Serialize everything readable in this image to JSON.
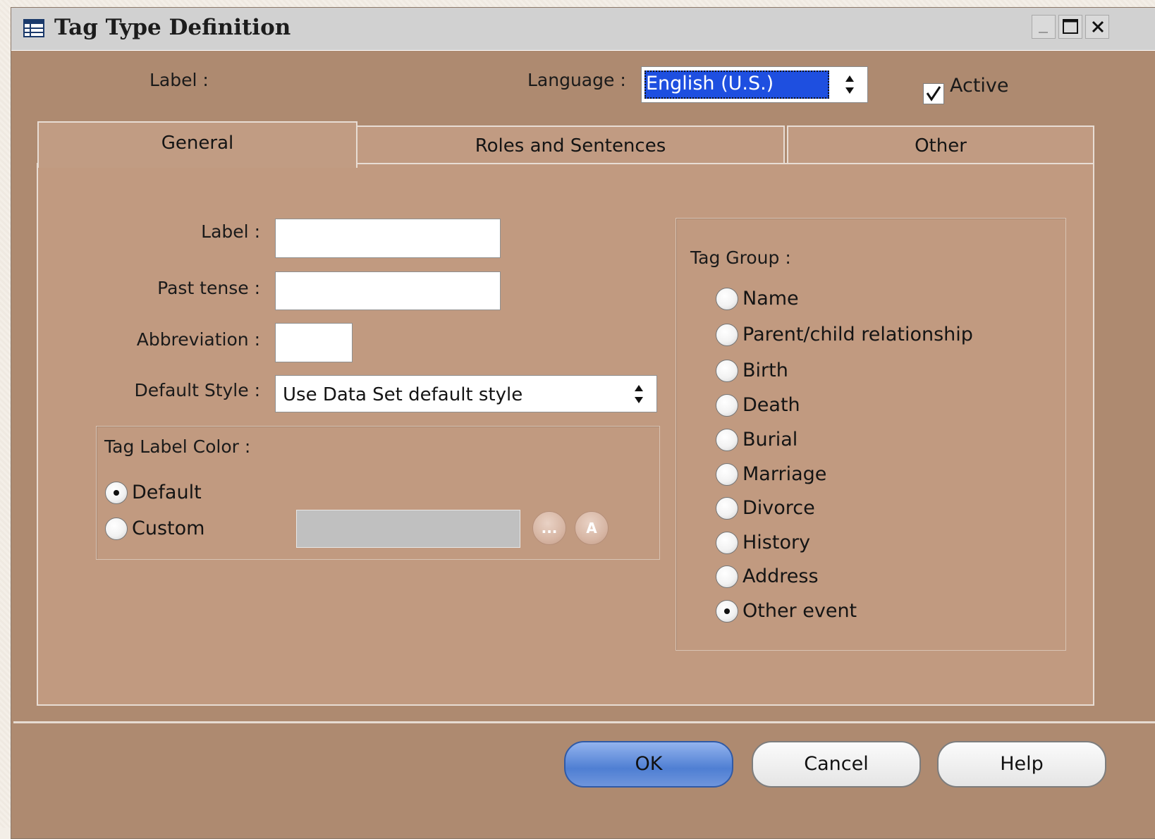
{
  "window": {
    "title": "Tag Type Definition",
    "icon": "table-window-icon"
  },
  "top_row": {
    "label_text": "Label :",
    "language_label": "Language :",
    "language_value": "English (U.S.)",
    "active_label": "Active",
    "active_checked": true
  },
  "tabs": [
    {
      "label": "General",
      "active": true
    },
    {
      "label": "Roles and Sentences",
      "active": false
    },
    {
      "label": "Other",
      "active": false
    }
  ],
  "general": {
    "label_field_label": "Label :",
    "label_value": "",
    "past_tense_label": "Past tense :",
    "past_tense_value": "",
    "abbreviation_label": "Abbreviation :",
    "abbreviation_value": "",
    "default_style_label": "Default Style :",
    "default_style_value": "Use Data Set default style",
    "color_group": {
      "title": "Tag Label Color :",
      "options": [
        {
          "label": "Default",
          "selected": true
        },
        {
          "label": "Custom",
          "selected": false
        }
      ],
      "ellipsis_button": "...",
      "font_button": "A"
    },
    "tag_group": {
      "title": "Tag Group :",
      "options": [
        {
          "label": "Name",
          "selected": false
        },
        {
          "label": "Parent/child relationship",
          "selected": false
        },
        {
          "label": "Birth",
          "selected": false
        },
        {
          "label": "Death",
          "selected": false
        },
        {
          "label": "Burial",
          "selected": false
        },
        {
          "label": "Marriage",
          "selected": false
        },
        {
          "label": "Divorce",
          "selected": false
        },
        {
          "label": "History",
          "selected": false
        },
        {
          "label": "Address",
          "selected": false
        },
        {
          "label": "Other event",
          "selected": true
        }
      ]
    }
  },
  "buttons": {
    "ok": "OK",
    "cancel": "Cancel",
    "help": "Help"
  },
  "colors": {
    "window_bg": "#ae8a70",
    "panel_bg": "#c19a80",
    "selection": "#1e4fe0",
    "ok_button": "#4f7fd3"
  }
}
